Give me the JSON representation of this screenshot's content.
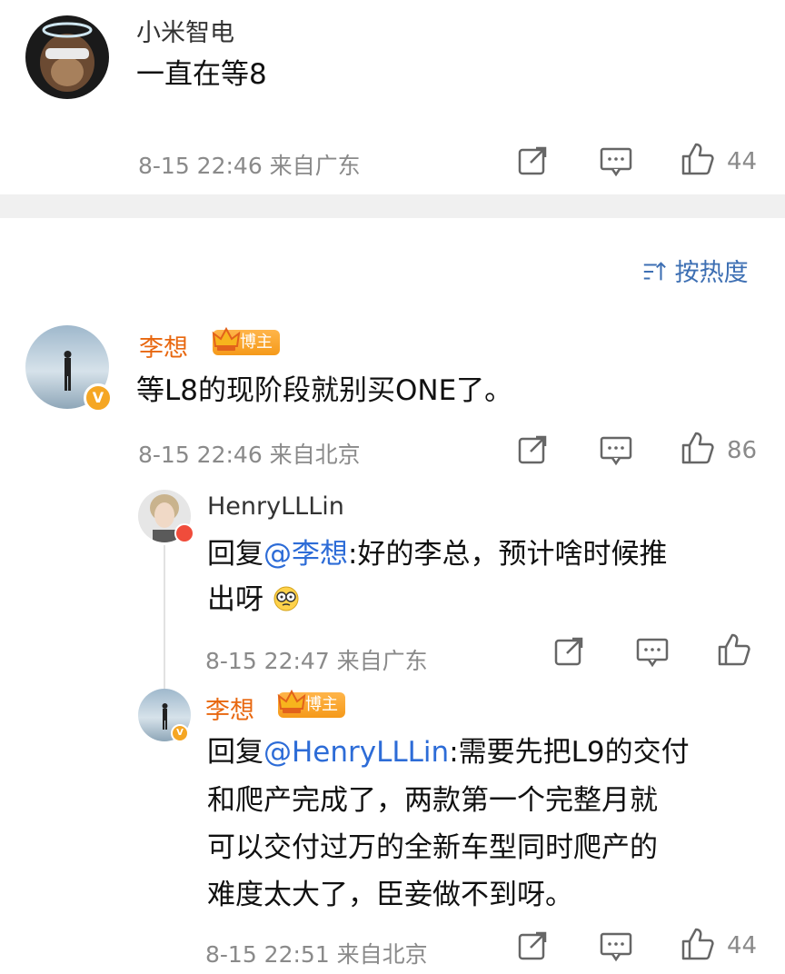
{
  "top_comment": {
    "username": "小米智电",
    "text": "一直在等8",
    "meta": "8-15 22:46 来自广东",
    "likes": "44"
  },
  "sort": {
    "label": "按热度"
  },
  "comment_main": {
    "username": "李想",
    "badge": "博主",
    "text": "等L8的现阶段就别买ONE了。",
    "meta": "8-15 22:46 来自北京",
    "likes": "86"
  },
  "reply1": {
    "username": "HenryLLLin",
    "prefix": "回复",
    "mention": "@李想",
    "text_line1": ":好的李总，预计啥时候推",
    "text_line2": "出呀",
    "meta": "8-15 22:47 来自广东"
  },
  "reply2": {
    "username": "李想",
    "badge": "博主",
    "prefix": "回复",
    "mention": "@HenryLLLin",
    "text_line1": ":需要先把L9的交付",
    "text_line2": "和爬产完成了，两款第一个完整月就",
    "text_line3": "可以交付过万的全新车型同时爬产的",
    "text_line4": "难度太大了，臣妾做不到呀。",
    "meta": "8-15 22:51 来自北京",
    "likes": "44"
  },
  "colors": {
    "vip_name": "#e8670f",
    "mention": "#2d6cd7",
    "sort_link": "#3d6fb3",
    "divider": "#f0f0f0"
  },
  "icons": [
    "share-icon",
    "comment-icon",
    "like-icon",
    "sort-icon",
    "verified-icon",
    "crown-icon",
    "emoji-icon"
  ]
}
